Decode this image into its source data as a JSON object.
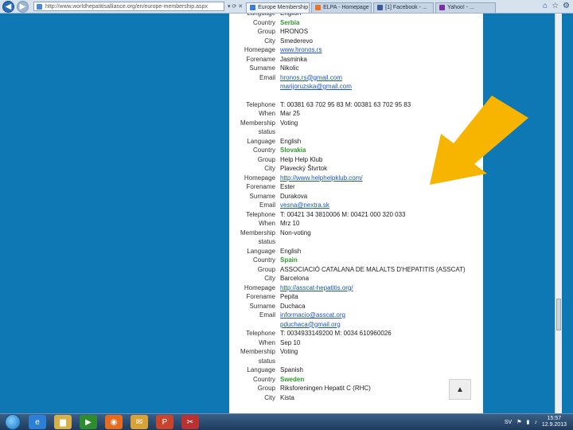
{
  "browser": {
    "address_url": "http://www.worldhepatitisalliance.org/en/europe-membership.aspx",
    "tools_text": "▾ ⟳ ✕",
    "tabs": [
      {
        "label": "Europe Membership - ...",
        "active": true,
        "color": "#3b7dd8"
      },
      {
        "label": "ELPA - Homepage - ELPA - ...",
        "active": false,
        "color": "#e8742a"
      },
      {
        "label": "[1] Facebook - ...",
        "active": false,
        "color": "#3b5998"
      },
      {
        "label": "Yahoo! - ...",
        "active": false,
        "color": "#7b2fa0"
      }
    ],
    "right_icons": [
      "home-icon",
      "star-icon",
      "gear-icon"
    ]
  },
  "listing": [
    {
      "label": "Language",
      "value": "English"
    },
    {
      "label": "Country",
      "value": "Serbia",
      "style": "green"
    },
    {
      "label": "Group",
      "value": "HRONOS"
    },
    {
      "label": "City",
      "value": "Smederevo"
    },
    {
      "label": "Homepage",
      "value": "www.hronos.rs",
      "style": "link"
    },
    {
      "label": "Forename",
      "value": "Jasminka"
    },
    {
      "label": "Surname",
      "value": "Nikolic"
    },
    {
      "label": "Email",
      "value": "hronos.rs@gmail.com",
      "style": "link"
    },
    {
      "label": "",
      "value": "marijoruzska@gmail.com",
      "style": "link"
    },
    {
      "label": "Telephone",
      "value": "T: 00381 63 702 95 83 M: 00381 63 702 95 83",
      "gap": true
    },
    {
      "label": "When",
      "value": "Mar 25"
    },
    {
      "label": "Membership",
      "value": "Voting"
    },
    {
      "label": "status",
      "value": ""
    },
    {
      "label": "Language",
      "value": "English"
    },
    {
      "label": "Country",
      "value": "Slovakia",
      "style": "green"
    },
    {
      "label": "Group",
      "value": "Help Help Klub"
    },
    {
      "label": "City",
      "value": "Plavecký Štvrtok"
    },
    {
      "label": "Homepage",
      "value": "http://www.helphelpklub.com/",
      "style": "link"
    },
    {
      "label": "Forename",
      "value": "Ester"
    },
    {
      "label": "Surname",
      "value": "Durakova"
    },
    {
      "label": "Email",
      "value": "vesna@nextra.sk",
      "style": "link"
    },
    {
      "label": "Telephone",
      "value": "T: 00421 34 3810006 M: 00421 000 320 033"
    },
    {
      "label": "When",
      "value": "Mrz 10"
    },
    {
      "label": "Membership",
      "value": "Non-voting"
    },
    {
      "label": "status",
      "value": ""
    },
    {
      "label": "Language",
      "value": "English"
    },
    {
      "label": "Country",
      "value": "Spain",
      "style": "green"
    },
    {
      "label": "Group",
      "value": "ASSOCIACIÓ CATALANA DE MALALTS D'HEPATITIS (ASSCAT)"
    },
    {
      "label": "City",
      "value": "Barcelona"
    },
    {
      "label": "Homepage",
      "value": "http://asscat-hepatitis.org/",
      "style": "link"
    },
    {
      "label": "Forename",
      "value": "Pepita"
    },
    {
      "label": "Surname",
      "value": "Duchaca"
    },
    {
      "label": "Email",
      "value": "informacio@asscat.org",
      "style": "link"
    },
    {
      "label": "",
      "value": "pduchaca@gmail.org",
      "style": "link"
    },
    {
      "label": "Telephone",
      "value": "T: 0034933149200 M: 0034 610960026"
    },
    {
      "label": "When",
      "value": "Sep 10"
    },
    {
      "label": "Membership",
      "value": "Voting"
    },
    {
      "label": "status",
      "value": ""
    },
    {
      "label": "Language",
      "value": "Spanish"
    },
    {
      "label": "Country",
      "value": "Sweden",
      "style": "green"
    },
    {
      "label": "Group",
      "value": "Riksforeningen Hepatit C (RHC)"
    },
    {
      "label": "City",
      "value": "Kista"
    }
  ],
  "scroll_top_label": "▲",
  "taskbar": {
    "lang": "SV",
    "time": "15:57",
    "date": "12.9.2013",
    "icons": [
      {
        "name": "ie-icon",
        "glyph": "e",
        "color": "#2b7fd6"
      },
      {
        "name": "folder-icon",
        "glyph": "▆",
        "color": "#d8b04a"
      },
      {
        "name": "media-player-icon",
        "glyph": "▶",
        "color": "#2e8c2e"
      },
      {
        "name": "firefox-icon",
        "glyph": "◉",
        "color": "#e46b1f"
      },
      {
        "name": "mail-icon",
        "glyph": "✉",
        "color": "#d7a23a"
      },
      {
        "name": "powerpoint-icon",
        "glyph": "P",
        "color": "#c8452c"
      },
      {
        "name": "tool-icon",
        "glyph": "✂",
        "color": "#b83232"
      }
    ]
  },
  "colors": {
    "background": "#0e78b4",
    "arrow": "#f7b500",
    "country": "#2f9a2f",
    "link": "#1d55b8"
  }
}
